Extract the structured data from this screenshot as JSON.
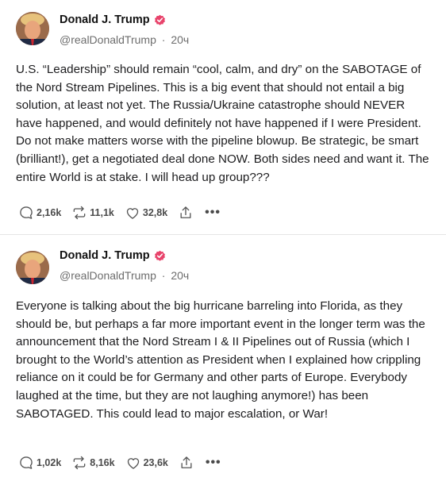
{
  "posts": [
    {
      "author": {
        "name": "Donald J. Trump",
        "handle": "@realDonaldTrump",
        "time": "20ч"
      },
      "text": "U.S. “Leadership” should remain “cool, calm, and dry” on the SABOTAGE of the Nord Stream Pipelines. This is a big event that should not entail a big solution, at least not yet. The Russia/Ukraine catastrophe should NEVER have happened, and would definitely not have happened if I were President. Do not make matters worse with the pipeline blowup. Be strategic, be smart (brilliant!), get a negotiated deal done NOW. Both sides need and want it. The entire World is at stake. I will head up group???",
      "stats": {
        "replies": "2,16k",
        "reposts": "11,1k",
        "likes": "32,8k"
      }
    },
    {
      "author": {
        "name": "Donald J. Trump",
        "handle": "@realDonaldTrump",
        "time": "20ч"
      },
      "text": "Everyone is talking about the big hurricane barreling into Florida, as they should be, but perhaps a far more important event in the longer term was the announcement that the Nord Stream I & II Pipelines out of Russia (which I brought to the World’s attention as President when I explained how crippling reliance on it could be for Germany and other parts of Europe. Everybody laughed at the time, but they are not laughing anymore!) has been SABOTAGED. This could lead to major escalation, or War!",
      "stats": {
        "replies": "1,02k",
        "reposts": "8,16k",
        "likes": "23,6k"
      }
    }
  ],
  "separator": "·",
  "more_glyph": "•••",
  "colors": {
    "verified_badge": "#e8436b",
    "text": "#1c1c1e",
    "muted": "#6d6d6d"
  },
  "icons": [
    "avatar",
    "verified-badge-icon",
    "reply-icon",
    "repost-icon",
    "like-icon",
    "share-icon",
    "more-icon"
  ]
}
